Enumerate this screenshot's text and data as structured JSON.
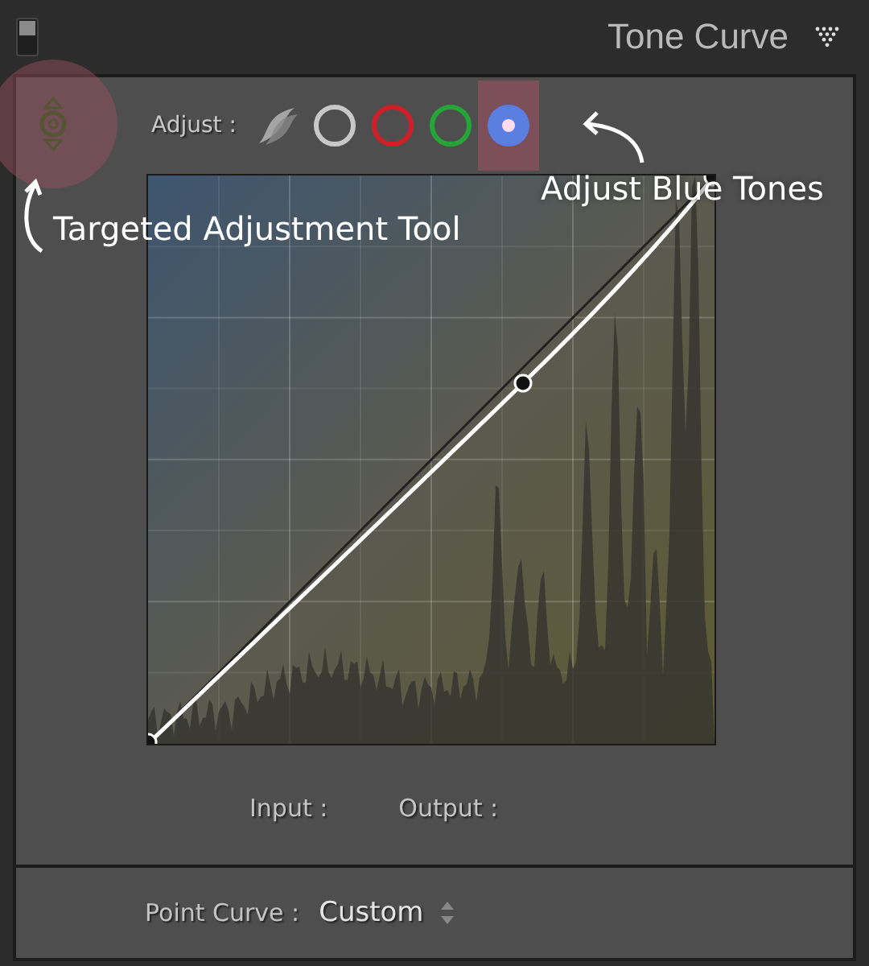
{
  "panel": {
    "title": "Tone Curve",
    "on": true
  },
  "adjust": {
    "label": "Adjust :",
    "channels": [
      {
        "kind": "composite",
        "selected": false
      },
      {
        "kind": "channel",
        "color": "#c8c8c8",
        "selected": false
      },
      {
        "kind": "channel",
        "color": "#cc1f28",
        "selected": false
      },
      {
        "kind": "channel",
        "color": "#25a535",
        "selected": false
      },
      {
        "kind": "channel",
        "color": "#5a7fe0",
        "selected": true
      }
    ]
  },
  "annotations": [
    {
      "text": "Targeted Adjustment Tool"
    },
    {
      "text": "Adjust Blue Tones"
    }
  ],
  "readout": {
    "input_label": "Input :",
    "output_label": "Output :"
  },
  "point_curve": {
    "label": "Point Curve :",
    "value": "Custom"
  }
}
